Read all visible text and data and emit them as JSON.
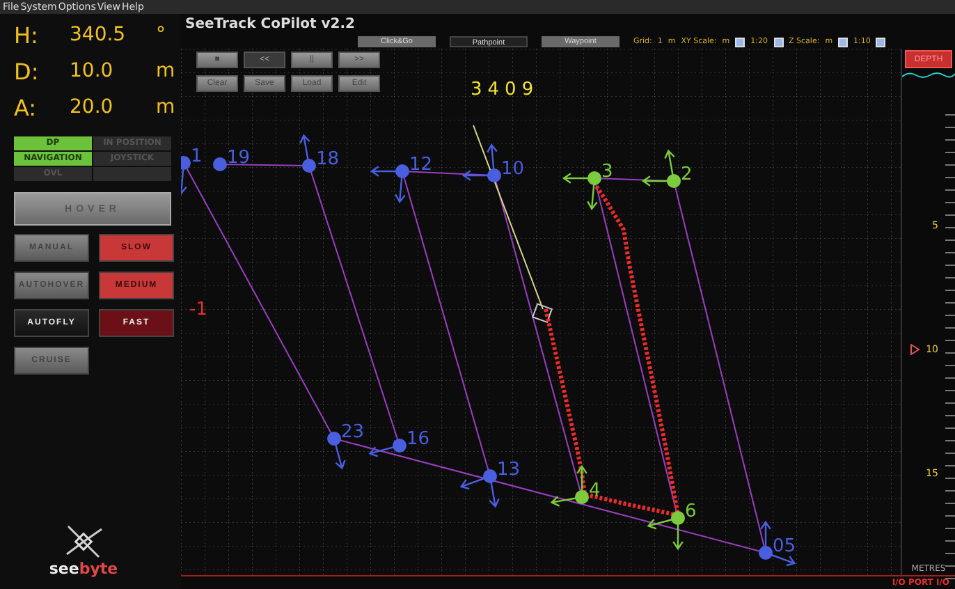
{
  "menu": [
    "File",
    "System",
    "Options",
    "View",
    "Help"
  ],
  "readouts": [
    {
      "label": "H:",
      "value": "340.5",
      "unit": "°"
    },
    {
      "label": "D:",
      "value": "10.0",
      "unit": "m"
    },
    {
      "label": "A:",
      "value": "20.0",
      "unit": "m"
    }
  ],
  "status": [
    {
      "label": "DP",
      "on": true
    },
    {
      "label": "IN POSITION",
      "on": false
    },
    {
      "label": "NAVIGATION",
      "on": true
    },
    {
      "label": "JOYSTICK",
      "on": false
    },
    {
      "label": "OVL",
      "on": false
    }
  ],
  "hover_button": "HOVER",
  "modes": [
    {
      "label": "MANUAL",
      "selected": false
    },
    {
      "label": "AUTOHOVER",
      "selected": false
    },
    {
      "label": "AUTOFLY",
      "selected": true
    },
    {
      "label": "CRUISE",
      "selected": false
    }
  ],
  "speeds": [
    {
      "label": "SLOW",
      "selected": false
    },
    {
      "label": "MEDIUM",
      "selected": false
    },
    {
      "label": "FAST",
      "selected": true
    }
  ],
  "logo": {
    "part_1": "see",
    "part_2": "byte"
  },
  "title": "SeeTrack CoPilot v2.2",
  "edit_modes": [
    {
      "label": "Click&Go",
      "selected": false
    },
    {
      "label": "Pathpoint",
      "selected": true
    },
    {
      "label": "Waypoint",
      "selected": false
    }
  ],
  "scale_bar": {
    "grid_label": "Grid:",
    "grid_value": "1",
    "grid_unit": "m",
    "xy_label": "XY Scale:",
    "xy_unit": "m",
    "xy_value": "1:20",
    "z_label": "Z Scale:",
    "z_unit": "m",
    "z_value": "1:10"
  },
  "playback": [
    {
      "label": "■",
      "disabled": false
    },
    {
      "label": "<<",
      "disabled": true
    },
    {
      "label": "||",
      "disabled": false
    },
    {
      "label": ">>",
      "disabled": false
    }
  ],
  "path_buttons": [
    "Clear",
    "Save",
    "Load",
    "Edit"
  ],
  "counter": "3409",
  "offset_label": "-1",
  "waypoints": [
    {
      "label": "1",
      "color": "#4a5fe0"
    },
    {
      "label": "19",
      "color": "#4a5fe0"
    },
    {
      "label": "18",
      "color": "#4a5fe0"
    },
    {
      "label": "12",
      "color": "#4a5fe0"
    },
    {
      "label": "10",
      "color": "#4a5fe0"
    },
    {
      "label": "3",
      "color": "#7ccb3c"
    },
    {
      "label": "2",
      "color": "#7ccb3c"
    },
    {
      "label": "23",
      "color": "#4a5fe0"
    },
    {
      "label": "16",
      "color": "#4a5fe0"
    },
    {
      "label": "13",
      "color": "#4a5fe0"
    },
    {
      "label": "4",
      "color": "#7ccb3c"
    },
    {
      "label": "6",
      "color": "#7ccb3c"
    },
    {
      "label": "05",
      "color": "#4a5fe0"
    }
  ],
  "depth": {
    "button": "DEPTH",
    "ticks": [
      "5",
      "10",
      "15"
    ],
    "unit": "METRES"
  },
  "status_bar": "I/O PORT I/O"
}
